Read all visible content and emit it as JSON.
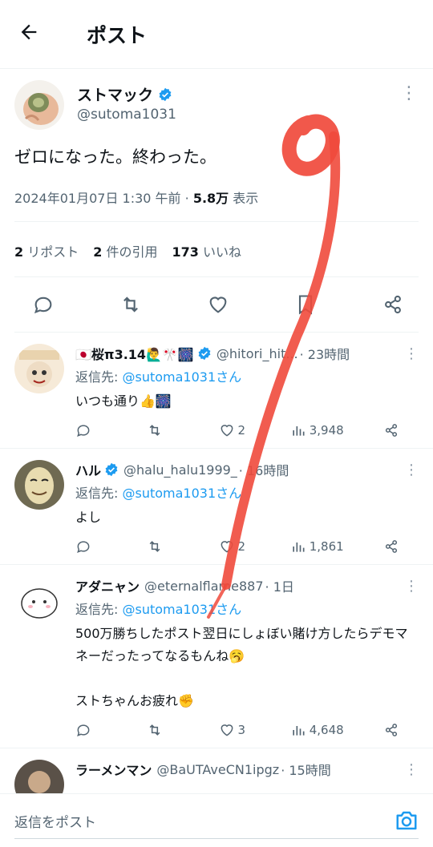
{
  "header": {
    "back_icon": "arrow-left-icon",
    "title": "ポスト"
  },
  "post": {
    "display_name": "ストマック",
    "handle": "@sutoma1031",
    "text": "ゼロになった。終わった。",
    "date": "2024年01月07日 1:30 午前",
    "views_count": "5.8万",
    "views_label": "表示",
    "reposts_count": "2",
    "reposts_label": "リポスト",
    "quotes_count": "2",
    "quotes_label": "件の引用",
    "likes_count": "173",
    "likes_label": "いいね"
  },
  "replies": [
    {
      "name": "🇯🇵桜π3.14🙋‍♂️🎌🎆",
      "verified": true,
      "handle": "@hitori_hit...",
      "time": "· 23時間",
      "reply_to_prefix": "返信先: ",
      "reply_to": "@sutoma1031さん",
      "text": "いつも通り👍🎆",
      "replies": "",
      "reposts": "",
      "likes": "2",
      "views": "3,948"
    },
    {
      "name": "ハル",
      "verified": true,
      "handle": "@halu_halu1999_",
      "time": "· 16時間",
      "reply_to_prefix": "返信先: ",
      "reply_to": "@sutoma1031さん",
      "text": "よし",
      "replies": "",
      "reposts": "",
      "likes": "2",
      "views": "1,861"
    },
    {
      "name": "アダニャン",
      "verified": false,
      "handle": "@eternalflame887",
      "time": "· 1日",
      "reply_to_prefix": "返信先: ",
      "reply_to": "@sutoma1031さん",
      "text": "500万勝ちしたポスト翌日にしょぼい賭け方したらデモマネーだったってなるもんね🥱\n\nストちゃんお疲れ✊",
      "replies": "",
      "reposts": "",
      "likes": "3",
      "views": "4,648"
    },
    {
      "name": "ラーメンマン",
      "verified": false,
      "handle": "@BaUTAveCN1ipgz",
      "time": "· 15時間",
      "reply_to_prefix": "",
      "reply_to": "",
      "text": "",
      "replies": "",
      "reposts": "",
      "likes": "",
      "views": ""
    }
  ],
  "compose": {
    "placeholder": "返信をポスト",
    "camera_icon": "camera-icon"
  },
  "colors": {
    "accent": "#1d9bf0",
    "text": "#0f1419",
    "secondary": "#536471",
    "scribble": "#f04a3c"
  }
}
